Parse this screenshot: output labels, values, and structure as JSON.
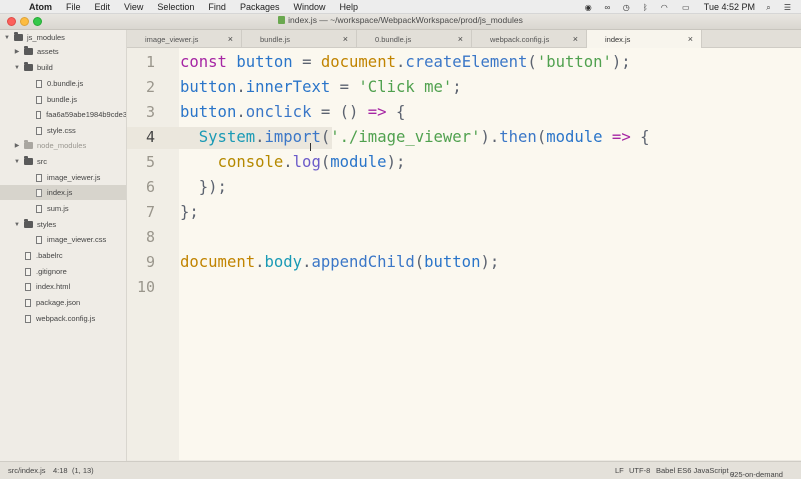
{
  "menubar": {
    "app_name": "Atom",
    "menus": [
      "File",
      "Edit",
      "View",
      "Selection",
      "Find",
      "Packages",
      "Window",
      "Help"
    ],
    "clock": "Tue 4:52 PM",
    "status_icons": [
      "record-icon",
      "glasses-icon",
      "time-machine-icon",
      "bluetooth-icon",
      "wifi-icon",
      "battery-icon",
      "search-icon",
      "list-icon"
    ]
  },
  "window": {
    "title": "index.js — ~/workspace/WebpackWorkspace/prod/js_modules"
  },
  "sidebar": {
    "items": [
      {
        "label": "js_modules",
        "type": "folder",
        "expanded": true
      },
      {
        "label": "assets",
        "type": "folder",
        "expanded": false
      },
      {
        "label": "build",
        "type": "folder",
        "expanded": true
      },
      {
        "label": "0.bundle.js",
        "type": "file"
      },
      {
        "label": "bundle.js",
        "type": "file"
      },
      {
        "label": "faa6a59abe1984b9cde3",
        "type": "file"
      },
      {
        "label": "style.css",
        "type": "file"
      },
      {
        "label": "node_modules",
        "type": "folder",
        "expanded": false
      },
      {
        "label": "src",
        "type": "folder",
        "expanded": true
      },
      {
        "label": "image_viewer.js",
        "type": "file"
      },
      {
        "label": "index.js",
        "type": "file",
        "selected": true
      },
      {
        "label": "sum.js",
        "type": "file"
      },
      {
        "label": "styles",
        "type": "folder",
        "expanded": true
      },
      {
        "label": "image_viewer.css",
        "type": "file"
      },
      {
        "label": ".babelrc",
        "type": "file"
      },
      {
        "label": ".gitignore",
        "type": "file"
      },
      {
        "label": "index.html",
        "type": "file"
      },
      {
        "label": "package.json",
        "type": "file"
      },
      {
        "label": "webpack.config.js",
        "type": "file"
      }
    ]
  },
  "tabs": [
    {
      "label": "image_viewer.js",
      "close": "×"
    },
    {
      "label": "bundle.js",
      "close": "×"
    },
    {
      "label": "0.bundle.js",
      "close": "×"
    },
    {
      "label": "webpack.config.js",
      "close": "×"
    },
    {
      "label": "index.js",
      "close": "×",
      "active": true
    }
  ],
  "editor": {
    "line_numbers": [
      "1",
      "2",
      "3",
      "4",
      "5",
      "6",
      "7",
      "8",
      "9",
      "10"
    ],
    "current_line": "4",
    "lines": [
      {
        "tokens": [
          {
            "t": "const ",
            "c": "kw"
          },
          {
            "t": "button",
            "c": "var"
          },
          {
            "t": " = ",
            "c": "plain"
          },
          {
            "t": "document",
            "c": "obj"
          },
          {
            "t": ".",
            "c": "plain"
          },
          {
            "t": "createElement",
            "c": "fn"
          },
          {
            "t": "(",
            "c": "plain"
          },
          {
            "t": "'button'",
            "c": "str"
          },
          {
            "t": ");",
            "c": "plain"
          }
        ]
      },
      {
        "tokens": [
          {
            "t": "button",
            "c": "var"
          },
          {
            "t": ".",
            "c": "plain"
          },
          {
            "t": "innerText",
            "c": "var"
          },
          {
            "t": " = ",
            "c": "plain"
          },
          {
            "t": "'Click me'",
            "c": "str"
          },
          {
            "t": ";",
            "c": "plain"
          }
        ]
      },
      {
        "tokens": [
          {
            "t": "button",
            "c": "var"
          },
          {
            "t": ".",
            "c": "plain"
          },
          {
            "t": "onclick",
            "c": "fn"
          },
          {
            "t": " = () ",
            "c": "plain"
          },
          {
            "t": "=>",
            "c": "kw"
          },
          {
            "t": " {",
            "c": "plain"
          }
        ]
      },
      {
        "tokens": [
          {
            "t": "  ",
            "c": "plain"
          },
          {
            "t": "System",
            "c": "teal"
          },
          {
            "t": ".",
            "c": "plain"
          },
          {
            "t": "import",
            "c": "fn"
          },
          {
            "t": "(",
            "c": "plain"
          },
          {
            "t": "'./image_viewer'",
            "c": "str"
          },
          {
            "t": ").",
            "c": "plain"
          },
          {
            "t": "then",
            "c": "fn"
          },
          {
            "t": "(",
            "c": "plain"
          },
          {
            "t": "module",
            "c": "var"
          },
          {
            "t": " => ",
            "c": "kw"
          },
          {
            "t": "{",
            "c": "plain"
          }
        ]
      },
      {
        "tokens": [
          {
            "t": "    ",
            "c": "plain"
          },
          {
            "t": "console",
            "c": "olive"
          },
          {
            "t": ".",
            "c": "plain"
          },
          {
            "t": "log",
            "c": "purple"
          },
          {
            "t": "(",
            "c": "plain"
          },
          {
            "t": "module",
            "c": "var"
          },
          {
            "t": ");",
            "c": "plain"
          }
        ]
      },
      {
        "tokens": [
          {
            "t": "  });",
            "c": "plain"
          }
        ]
      },
      {
        "tokens": [
          {
            "t": "};",
            "c": "plain"
          }
        ]
      },
      {
        "tokens": []
      },
      {
        "tokens": [
          {
            "t": "document",
            "c": "obj"
          },
          {
            "t": ".",
            "c": "plain"
          },
          {
            "t": "body",
            "c": "teal"
          },
          {
            "t": ".",
            "c": "plain"
          },
          {
            "t": "appendChild",
            "c": "fn"
          },
          {
            "t": "(",
            "c": "plain"
          },
          {
            "t": "button",
            "c": "var"
          },
          {
            "t": ");",
            "c": "plain"
          }
        ]
      },
      {
        "tokens": []
      }
    ]
  },
  "statusbar": {
    "file_path": "src/index.js",
    "cursor_position": "4:18",
    "selection": "(1, 13)",
    "line_ending": "LF",
    "encoding": "UTF-8",
    "grammar": "Babel ES6 JavaScript",
    "branch": "025-on-demand"
  }
}
